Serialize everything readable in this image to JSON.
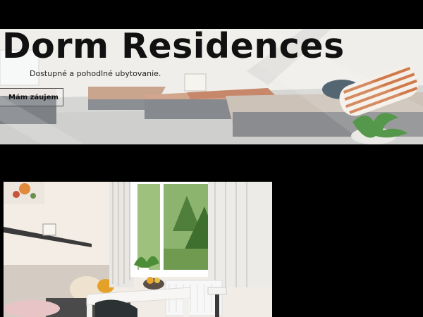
{
  "hero": {
    "title": "Dorm Residences",
    "subtitle": "Dostupné a pohodlné ubytovanie.",
    "cta_label": "Mám záujem"
  },
  "images": {
    "hero_photo": "dormitory-room-with-beds",
    "room_photo": "room-with-window-and-table"
  },
  "colors": {
    "background": "#000000",
    "title": "#111111"
  }
}
